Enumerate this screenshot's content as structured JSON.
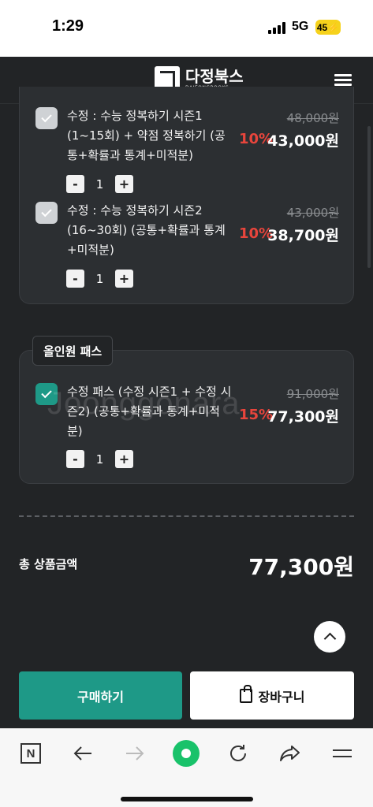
{
  "status": {
    "time": "1:29",
    "network": "5G",
    "battery": "45"
  },
  "header": {
    "logo_name": "다정북스",
    "logo_sub": "DAJEONGBOOKS",
    "menu_icon": "hamburger-menu-icon"
  },
  "items": [
    {
      "name": "수정 : 수능 정복하기 시즌1 (1~15회) + 약점 정복하기 (공통+확률과 통계+미적분)",
      "discount": "10%",
      "orig_price": "48,000원",
      "sale_price": "43,000원",
      "qty": "1",
      "checked": true
    },
    {
      "name": "수정 : 수능 정복하기 시즌2 (16~30회) (공통+확률과 통계+미적분)",
      "discount": "10%",
      "orig_price": "43,000원",
      "sale_price": "38,700원",
      "qty": "1",
      "checked": true
    }
  ],
  "pass": {
    "tag": "올인원 패스",
    "name": "수정 패스 (수정 시즌1 + 수정 시즌2) (공통+확률과 통계+미적분)",
    "discount": "15%",
    "orig_price": "91,000원",
    "sale_price": "77,300원",
    "qty": "1",
    "checked": true
  },
  "watermark": "Joonggonara",
  "summary": {
    "label": "총 상품금액",
    "total": "77,300원"
  },
  "buttons": {
    "buy": "구매하기",
    "cart": "장바구니"
  },
  "stepper": {
    "minus": "-",
    "plus": "+"
  },
  "browser": {
    "n_label": "N"
  },
  "colors": {
    "accent": "#1e9987",
    "discount": "#e8453c",
    "background": "#222426"
  }
}
